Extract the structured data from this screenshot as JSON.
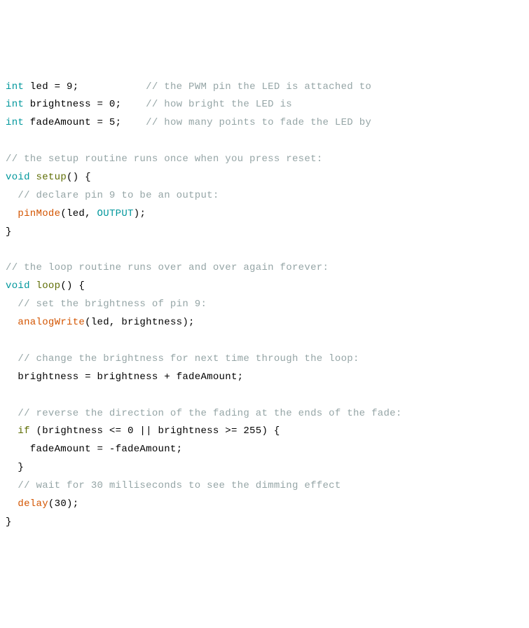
{
  "code": {
    "l1": {
      "kw": "int",
      "name": " led = 9;           ",
      "comment": "// the PWM pin the LED is attached to"
    },
    "l2": {
      "kw": "int",
      "name": " brightness = 0;    ",
      "comment": "// how bright the LED is"
    },
    "l3": {
      "kw": "int",
      "name": " fadeAmount = 5;    ",
      "comment": "// how many points to fade the LED by"
    },
    "l5": {
      "comment": "// the setup routine runs once when you press reset:"
    },
    "l6": {
      "kw": "void",
      "fn": " setup",
      "rest": "() {"
    },
    "l7": {
      "comment": "  // declare pin 9 to be an output:"
    },
    "l8": {
      "indent": "  ",
      "fn": "pinMode",
      "open": "(led, ",
      "const": "OUTPUT",
      "close": ");"
    },
    "l9": {
      "text": "}"
    },
    "l11": {
      "comment": "// the loop routine runs over and over again forever:"
    },
    "l12": {
      "kw": "void",
      "fn": " loop",
      "rest": "() {"
    },
    "l13": {
      "comment": "  // set the brightness of pin 9:"
    },
    "l14": {
      "indent": "  ",
      "fn": "analogWrite",
      "rest": "(led, brightness);"
    },
    "l16": {
      "comment": "  // change the brightness for next time through the loop:"
    },
    "l17": {
      "text": "  brightness = brightness + fadeAmount;"
    },
    "l19": {
      "comment": "  // reverse the direction of the fading at the ends of the fade:"
    },
    "l20": {
      "indent": "  ",
      "kw": "if",
      "rest": " (brightness <= 0 || brightness >= 255) {"
    },
    "l21": {
      "text": "    fadeAmount = -fadeAmount;"
    },
    "l22": {
      "text": "  }"
    },
    "l23": {
      "comment": "  // wait for 30 milliseconds to see the dimming effect"
    },
    "l24": {
      "indent": "  ",
      "fn": "delay",
      "rest": "(30);"
    },
    "l25": {
      "text": "}"
    }
  }
}
